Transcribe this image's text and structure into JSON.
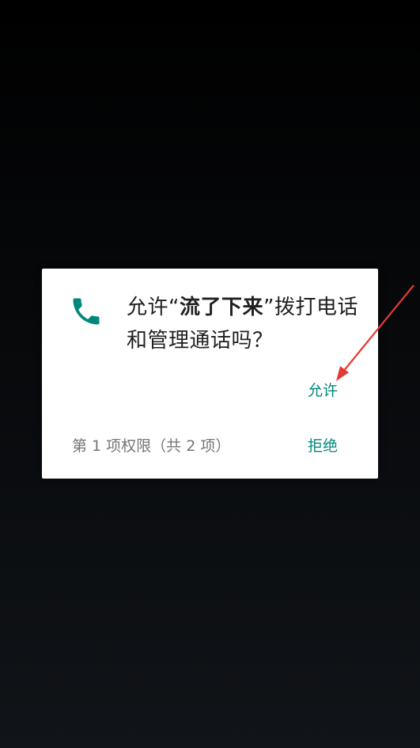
{
  "dialog": {
    "icon": "phone-icon",
    "title_prefix": "允许“",
    "app_name": "流了下来",
    "title_suffix": "”拨打电话和管理通话吗？",
    "allow_label": "允许",
    "deny_label": "拒绝",
    "permission_counter": "第 1 项权限（共 2 项）"
  },
  "colors": {
    "accent": "#00897b",
    "annotation_arrow": "#e53935",
    "background": "#000000",
    "dialog_bg": "#ffffff"
  }
}
